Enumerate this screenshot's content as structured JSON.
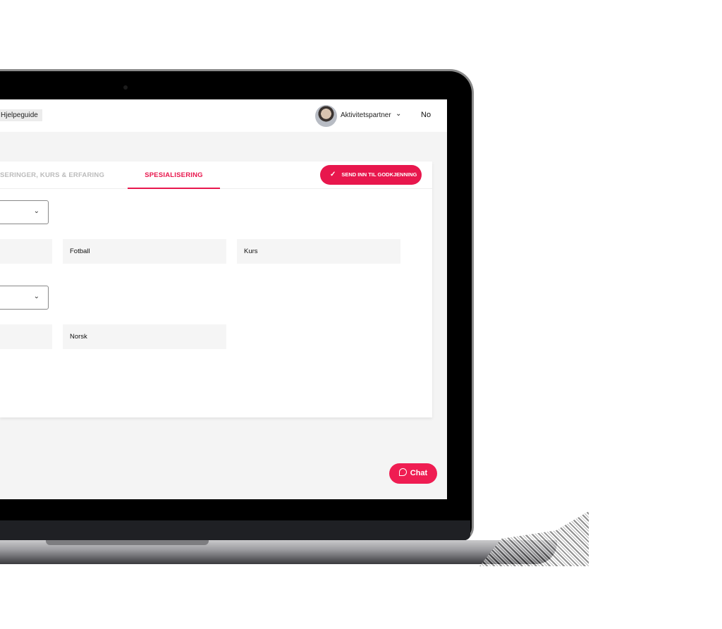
{
  "header": {
    "help_label": "Hjelpeguide",
    "user_name": "Aktivitetspartner",
    "chevron_icon": "chevron-down-icon",
    "language": "No"
  },
  "tabs": [
    {
      "label": "SERINGER, KURS & ERFARING",
      "active": false
    },
    {
      "label": "SPESIALISERING",
      "active": true
    }
  ],
  "submit_button": {
    "icon": "check-icon",
    "label": "SEND INN TIL GODKJENNING"
  },
  "sections": [
    {
      "dropdown_value": "",
      "chips": [
        "",
        "Fotball",
        "Kurs"
      ]
    },
    {
      "dropdown_value": "",
      "chips": [
        "",
        "Norsk"
      ]
    }
  ],
  "chat_button": {
    "icon": "chat-bubble-icon",
    "label": "Chat"
  },
  "colors": {
    "accent": "#e8174d",
    "background": "#f4f4f4"
  }
}
